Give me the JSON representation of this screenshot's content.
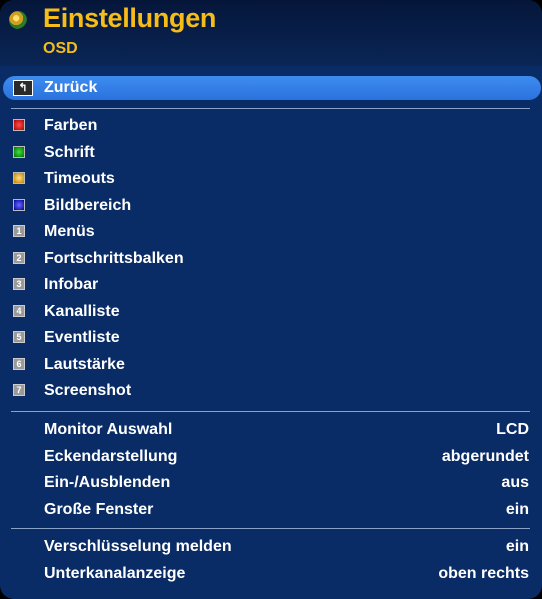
{
  "header": {
    "title": "Einstellungen",
    "subtitle": "OSD"
  },
  "back": {
    "label": "Zurück"
  },
  "menu_items": [
    {
      "label": "Farben",
      "key": "red"
    },
    {
      "label": "Schrift",
      "key": "green"
    },
    {
      "label": "Timeouts",
      "key": "yellow"
    },
    {
      "label": "Bildbereich",
      "key": "blue"
    },
    {
      "label": "Menüs",
      "key": "1"
    },
    {
      "label": "Fortschrittsbalken",
      "key": "2"
    },
    {
      "label": "Infobar",
      "key": "3"
    },
    {
      "label": "Kanalliste",
      "key": "4"
    },
    {
      "label": "Eventliste",
      "key": "5"
    },
    {
      "label": "Lautstärke",
      "key": "6"
    },
    {
      "label": "Screenshot",
      "key": "7"
    }
  ],
  "settings_group_1": [
    {
      "label": "Monitor Auswahl",
      "value": "LCD"
    },
    {
      "label": "Eckendarstellung",
      "value": "abgerundet"
    },
    {
      "label": "Ein-/Ausblenden",
      "value": "aus"
    },
    {
      "label": "Große Fenster",
      "value": "ein"
    }
  ],
  "settings_group_2": [
    {
      "label": "Verschlüsselung melden",
      "value": "ein"
    },
    {
      "label": "Unterkanalanzeige",
      "value": "oben rechts"
    }
  ],
  "colors": {
    "title": "#f6bd18",
    "selection": "#3e8cf0",
    "background": "#0a2c66"
  }
}
